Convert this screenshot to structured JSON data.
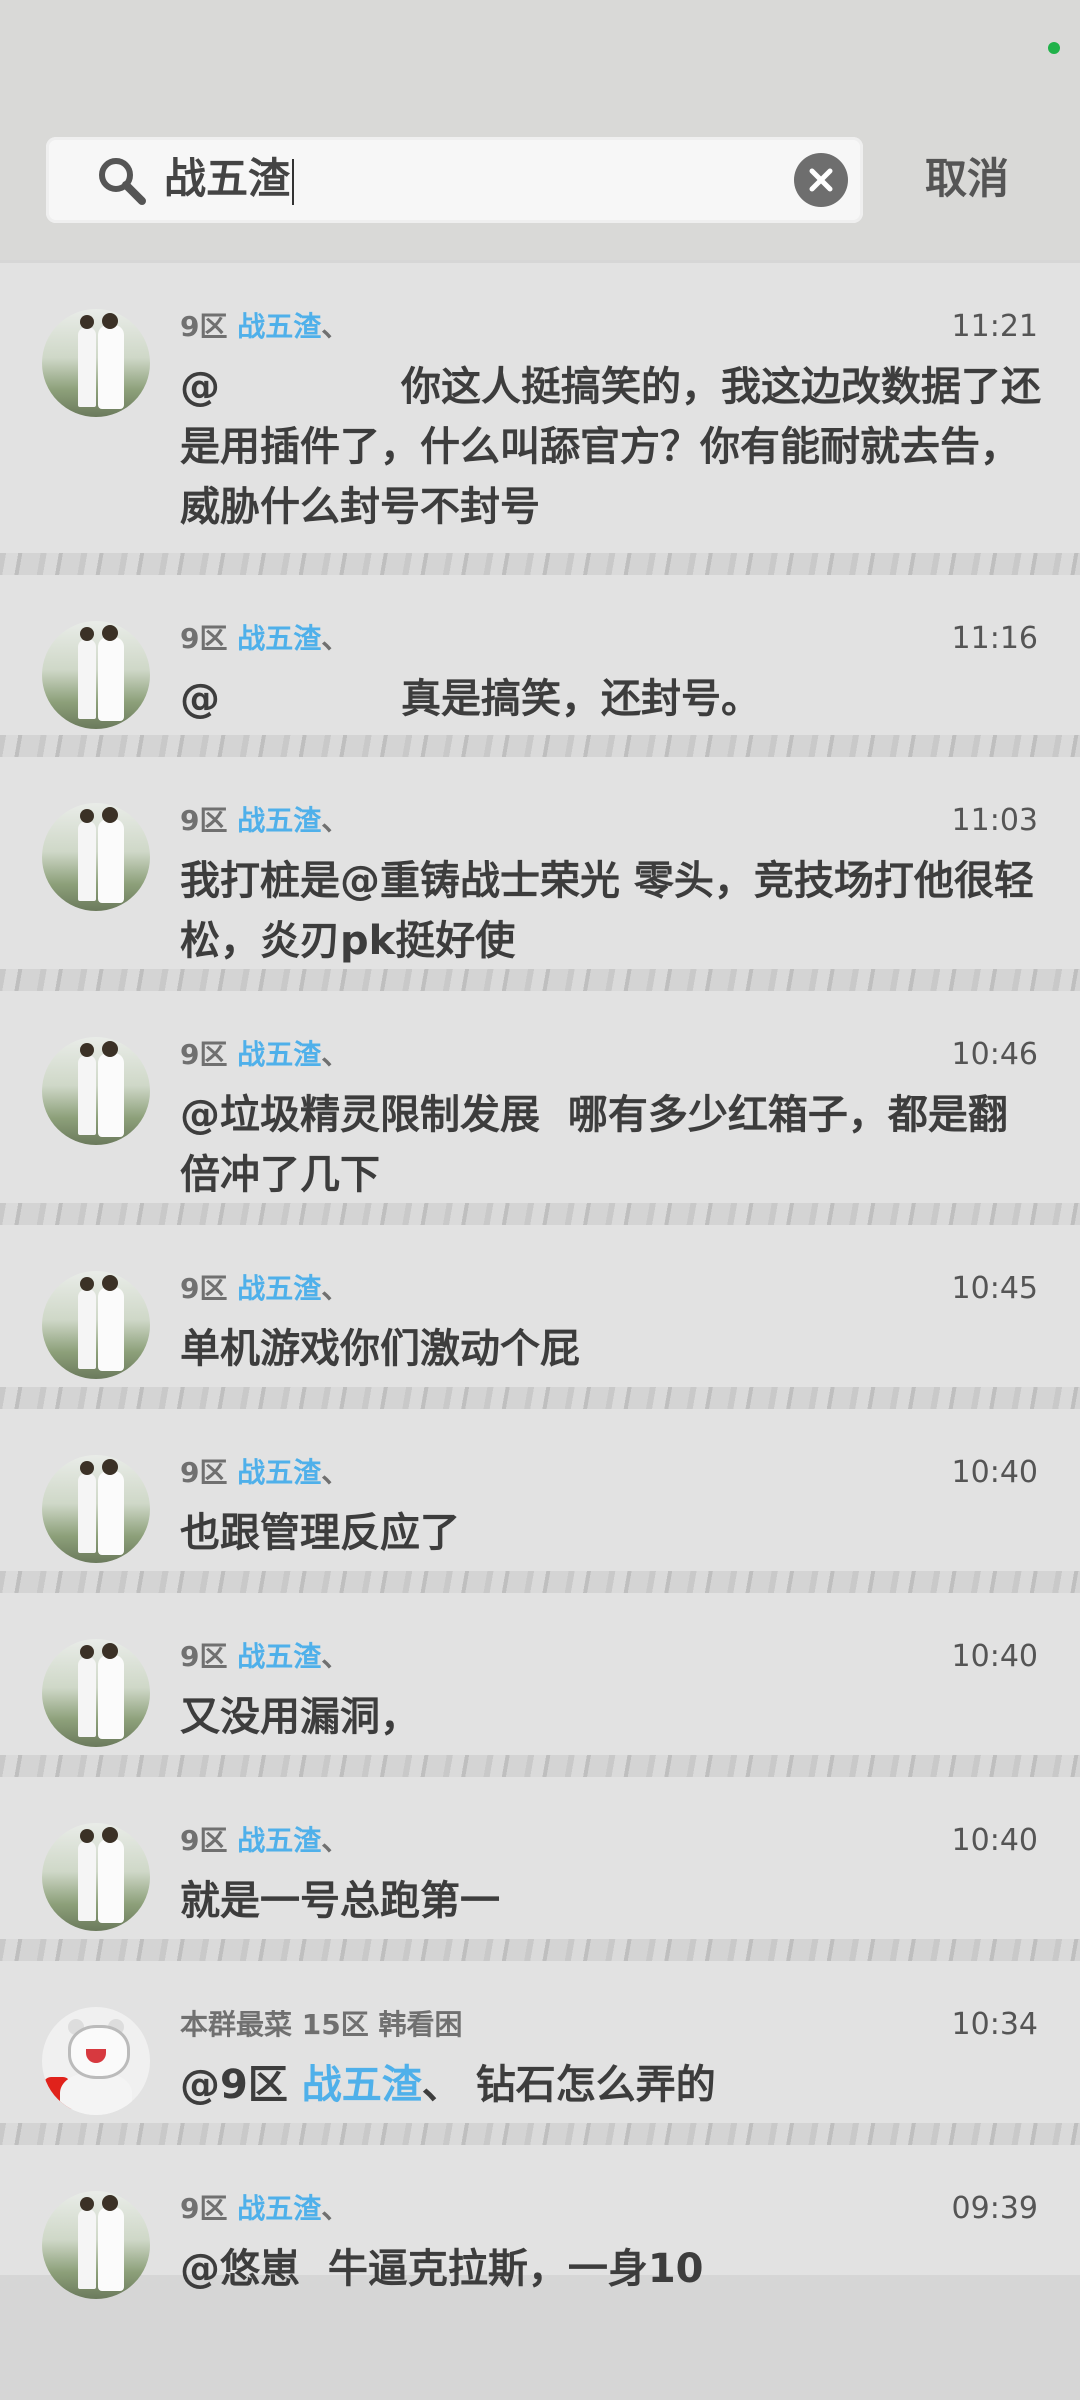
{
  "search": {
    "query": "战五渣",
    "cancel_label": "取消"
  },
  "colors": {
    "highlight": "#4fb0ea",
    "status_dot": "#21b24a"
  },
  "results": [
    {
      "sender_prefix": "9区",
      "sender_match": "战五渣",
      "sender_suffix": "、",
      "time": "11:21",
      "msg_before": "@",
      "msg_match": "",
      "msg_after": "             你这人挺搞笑的，我这边改数据了还是用插件了，什么叫舔官方？你有能耐就去告，威胁什么封号不封号"
    },
    {
      "sender_prefix": "9区",
      "sender_match": "战五渣",
      "sender_suffix": "、",
      "time": "11:16",
      "msg_before": "@",
      "msg_match": "",
      "msg_after": "             真是搞笑，还封号。"
    },
    {
      "sender_prefix": "9区",
      "sender_match": "战五渣",
      "sender_suffix": "、",
      "time": "11:03",
      "msg_before": "我打桩是@重铸战士荣光 零头，竞技场打他很轻松，炎刃pk挺好使",
      "msg_match": "",
      "msg_after": ""
    },
    {
      "sender_prefix": "9区",
      "sender_match": "战五渣",
      "sender_suffix": "、",
      "time": "10:46",
      "msg_before": "@垃圾精灵限制发展  哪有多少红箱子，都是翻倍冲了几下",
      "msg_match": "",
      "msg_after": ""
    },
    {
      "sender_prefix": "9区",
      "sender_match": "战五渣",
      "sender_suffix": "、",
      "time": "10:45",
      "msg_before": "单机游戏你们激动个屁",
      "msg_match": "",
      "msg_after": ""
    },
    {
      "sender_prefix": "9区",
      "sender_match": "战五渣",
      "sender_suffix": "、",
      "time": "10:40",
      "msg_before": "也跟管理反应了",
      "msg_match": "",
      "msg_after": ""
    },
    {
      "sender_prefix": "9区",
      "sender_match": "战五渣",
      "sender_suffix": "、",
      "time": "10:40",
      "msg_before": "又没用漏洞，",
      "msg_match": "",
      "msg_after": ""
    },
    {
      "sender_prefix": "9区",
      "sender_match": "战五渣",
      "sender_suffix": "、",
      "time": "10:40",
      "msg_before": "就是一号总跑第一",
      "msg_match": "",
      "msg_after": ""
    },
    {
      "sender_prefix": "本群最菜 15区 韩看困",
      "sender_match": "",
      "sender_suffix": "",
      "time": "10:34",
      "msg_before": "@9区 ",
      "msg_match": "战五渣",
      "msg_after": "、 钻石怎么弄的"
    },
    {
      "sender_prefix": "9区",
      "sender_match": "战五渣",
      "sender_suffix": "、",
      "time": "09:39",
      "msg_before": "@悠崽  牛逼克拉斯，一身10",
      "msg_match": "",
      "msg_after": ""
    }
  ]
}
